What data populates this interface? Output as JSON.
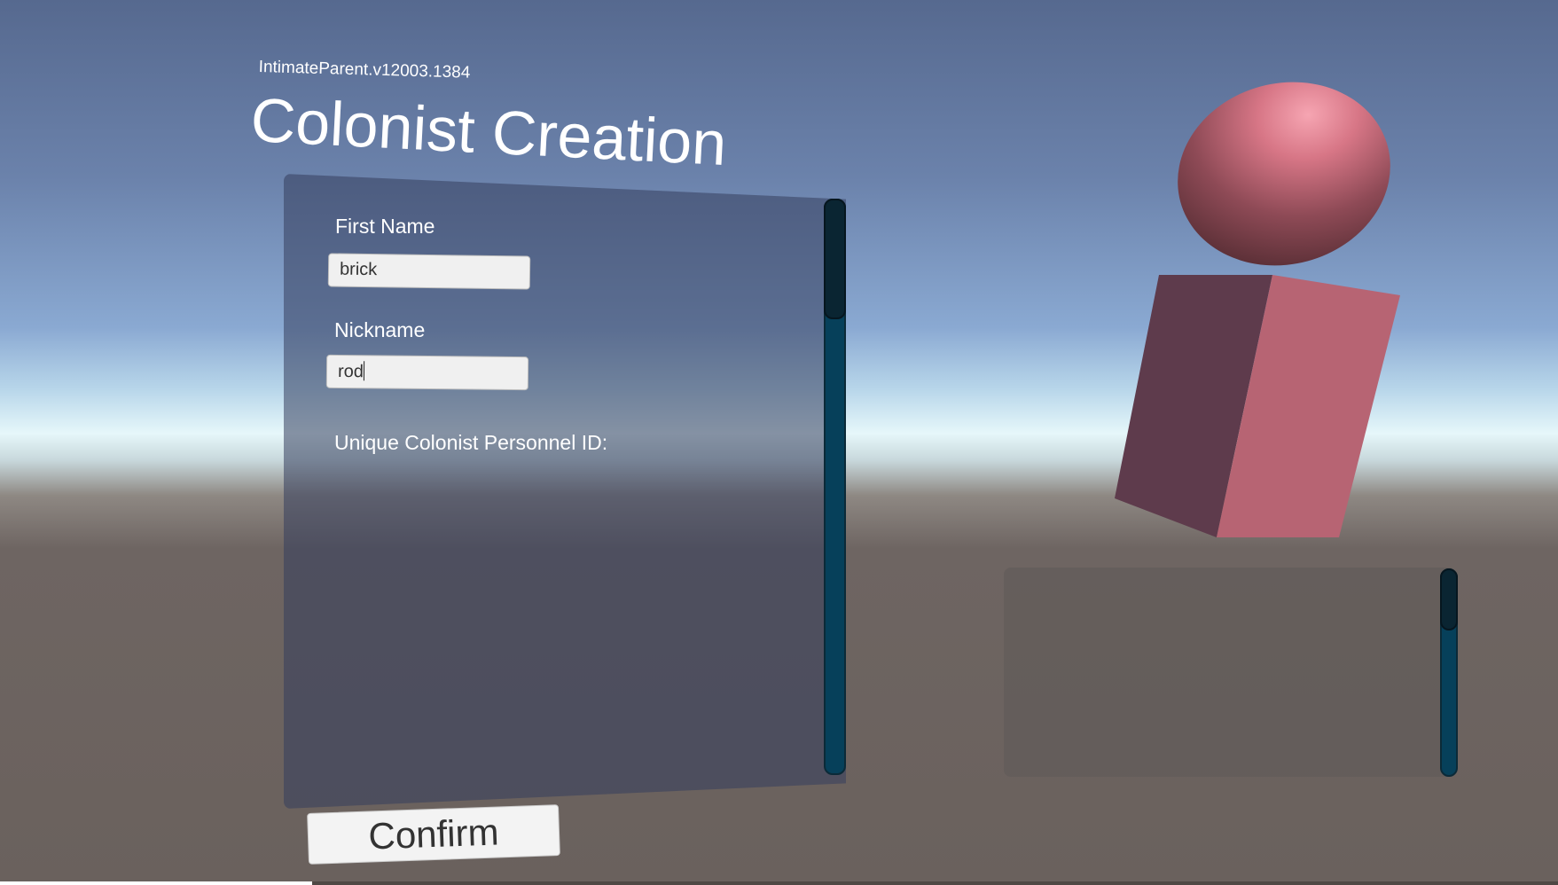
{
  "header": {
    "version": "IntimateParent.v12003.1384",
    "title": "Colonist Creation"
  },
  "form": {
    "first_name_label": "First Name",
    "first_name_value": "brick",
    "nickname_label": "Nickname",
    "nickname_value": "rod",
    "personnel_id_label": "Unique Colonist Personnel ID:"
  },
  "actions": {
    "confirm_label": "Confirm"
  },
  "colors": {
    "scrollbar": "#06405a",
    "object": "#b76473"
  }
}
